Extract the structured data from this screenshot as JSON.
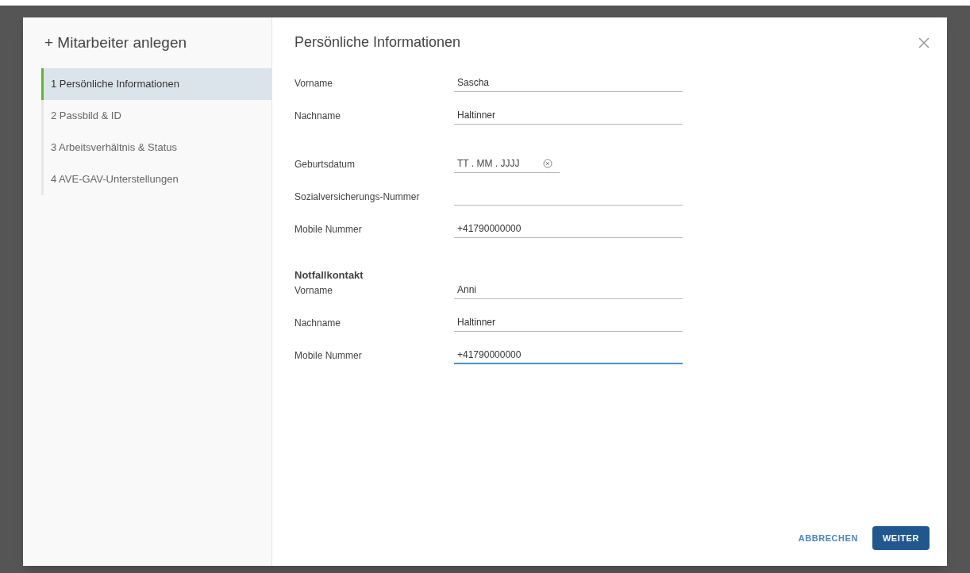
{
  "dialog": {
    "title": "+ Mitarbeiter anlegen",
    "heading": "Persönliche Informationen"
  },
  "steps": [
    {
      "label": "1 Persönliche Informationen",
      "selected": true
    },
    {
      "label": "2 Passbild & ID",
      "selected": false
    },
    {
      "label": "3 Arbeitsverhältnis & Status",
      "selected": false
    },
    {
      "label": "4 AVE-GAV-Unterstellungen",
      "selected": false
    }
  ],
  "sections": [
    {
      "fields": [
        {
          "kind": "text",
          "label": "Vorname",
          "value": "Sascha",
          "focused": false
        },
        {
          "kind": "text",
          "label": "Nachname",
          "value": "Haltinner",
          "focused": false
        }
      ]
    },
    {
      "fields": [
        {
          "kind": "date",
          "label": "Geburtsdatum",
          "placeholder": "TT . MM . JJJJ",
          "focused": false
        },
        {
          "kind": "text",
          "label": "Sozialversicherungs-Nummer",
          "focused": false
        },
        {
          "kind": "text",
          "label": "Mobile Nummer",
          "value": "+41790000000",
          "focused": false
        }
      ]
    },
    {
      "title": "Notfallkontakt",
      "fields": [
        {
          "kind": "text",
          "label": "Vorname",
          "value": "Anni",
          "focused": false
        },
        {
          "kind": "text",
          "label": "Nachname",
          "value": "Haltinner",
          "focused": false
        },
        {
          "kind": "text",
          "label": "Mobile Nummer",
          "value": "+41790000000",
          "focused": true
        }
      ]
    }
  ],
  "buttons": [
    {
      "kind": "flat",
      "label": "ABBRECHEN"
    },
    {
      "kind": "primary",
      "label": "WEITER"
    }
  ]
}
